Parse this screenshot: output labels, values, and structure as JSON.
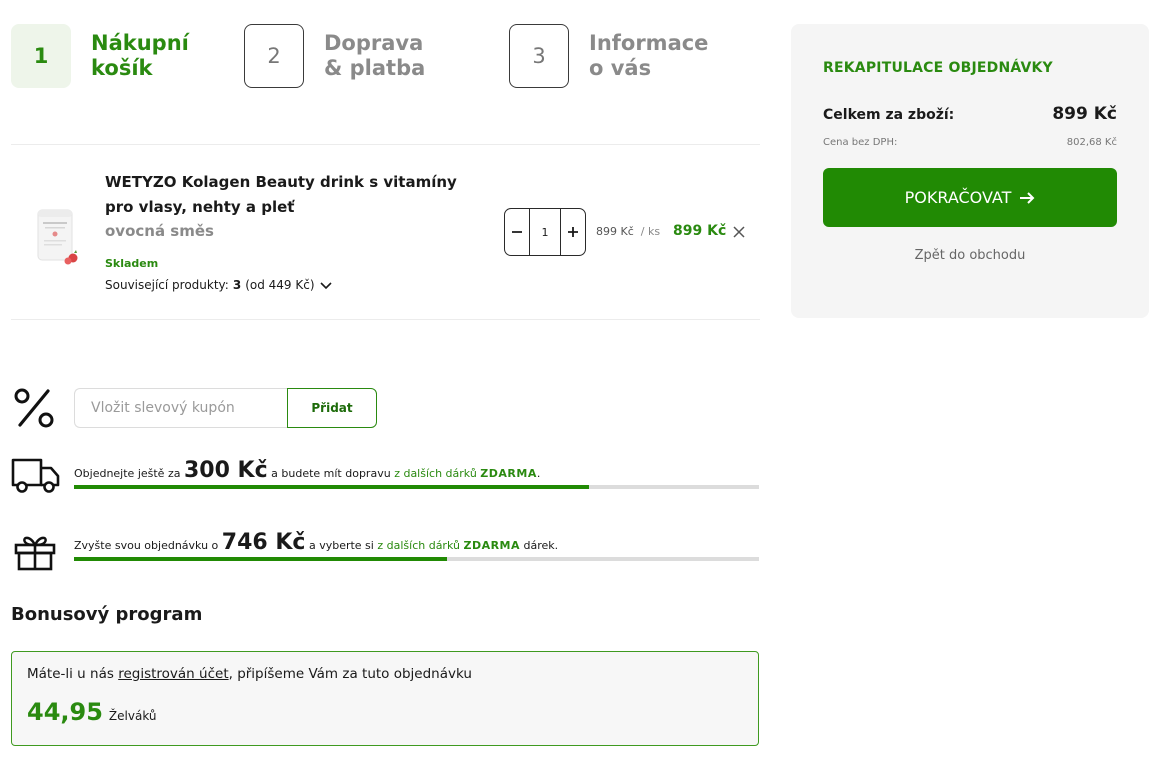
{
  "steps": [
    {
      "number": "1",
      "label": "Nákupní\nkošík"
    },
    {
      "number": "2",
      "label": "Doprava\n& platba"
    },
    {
      "number": "3",
      "label": "Informace\no vás"
    }
  ],
  "product": {
    "name": "WETYZO Kolagen Beauty drink s vitamíny pro vlasy, nehty a pleť",
    "variant": "ovocná směs",
    "stock": "Skladem",
    "related_label": "Související produkty:",
    "related_count": "3",
    "related_from": "(od 449 Kč)",
    "quantity": "1",
    "unit_price": "899 Kč",
    "unit_suffix": "/ ks",
    "line_price": "899 Kč"
  },
  "summary": {
    "title": "REKAPITULACE OBJEDNÁVKY",
    "total_label": "Celkem za zboží:",
    "total_value": "899 Kč",
    "vat_label": "Cena bez DPH:",
    "vat_value": "802,68 Kč",
    "continue_label": "POKRAČOVAT",
    "back_label": "Zpět do obchodu"
  },
  "coupon": {
    "placeholder": "Vložit slevový kupón",
    "button_label": "Přidat"
  },
  "shipping_progress": {
    "prefix": "Objednejte ještě za",
    "amount": "300 Kč",
    "middle": "a budete mít dopravu",
    "link": "z dalších dárků",
    "free": "ZDARMA",
    "suffix": ".",
    "fill": 0.752
  },
  "gift_progress": {
    "prefix": "Zvyšte svou objednávku o",
    "amount": "746 Kč",
    "middle": "a vyberte si",
    "link": "z dalších dárků",
    "free": "ZDARMA",
    "suffix": "dárek.",
    "fill": 0.545
  },
  "bonus": {
    "title": "Bonusový program",
    "text_before": "Máte-li u nás",
    "link": "registrován účet",
    "text_after": ", připíšeme Vám za tuto objednávku",
    "points": "44,95",
    "unit": "Želváků"
  },
  "colors": {
    "accent": "#218a04",
    "accent_text": "#2a8a10",
    "summary_bg": "#f5f5f5",
    "progress_track": "#dcdcdc"
  }
}
